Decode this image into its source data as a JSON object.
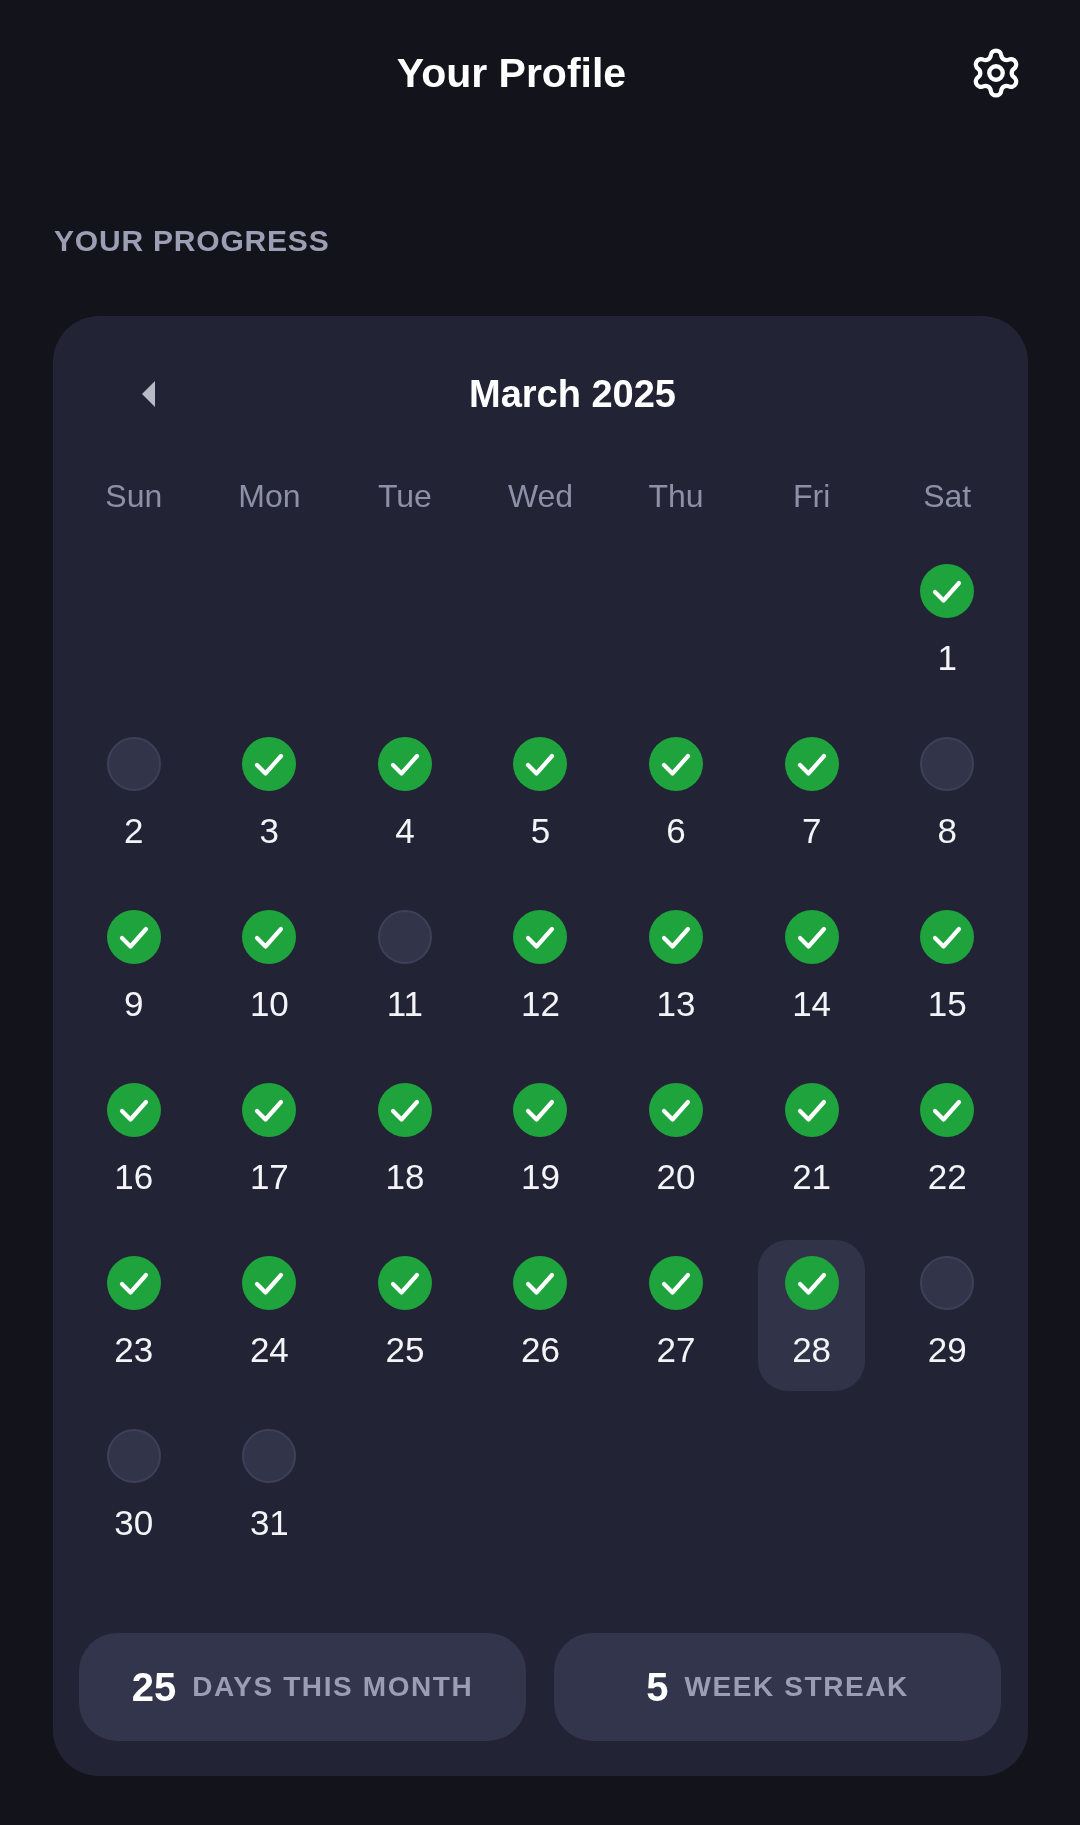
{
  "header": {
    "title": "Your Profile"
  },
  "section_title": "YOUR PROGRESS",
  "calendar": {
    "month": "March 2025",
    "weekdays": [
      "Sun",
      "Mon",
      "Tue",
      "Wed",
      "Thu",
      "Fri",
      "Sat"
    ],
    "weeks": [
      [
        {
          "day": "1",
          "checked": true,
          "selected": false
        }
      ],
      [
        {
          "day": "2",
          "checked": false,
          "selected": false
        },
        {
          "day": "3",
          "checked": true,
          "selected": false
        },
        {
          "day": "4",
          "checked": true,
          "selected": false
        },
        {
          "day": "5",
          "checked": true,
          "selected": false
        },
        {
          "day": "6",
          "checked": true,
          "selected": false
        },
        {
          "day": "7",
          "checked": true,
          "selected": false
        },
        {
          "day": "8",
          "checked": false,
          "selected": false
        }
      ],
      [
        {
          "day": "9",
          "checked": true,
          "selected": false
        },
        {
          "day": "10",
          "checked": true,
          "selected": false
        },
        {
          "day": "11",
          "checked": false,
          "selected": false
        },
        {
          "day": "12",
          "checked": true,
          "selected": false
        },
        {
          "day": "13",
          "checked": true,
          "selected": false
        },
        {
          "day": "14",
          "checked": true,
          "selected": false
        },
        {
          "day": "15",
          "checked": true,
          "selected": false
        }
      ],
      [
        {
          "day": "16",
          "checked": true,
          "selected": false
        },
        {
          "day": "17",
          "checked": true,
          "selected": false
        },
        {
          "day": "18",
          "checked": true,
          "selected": false
        },
        {
          "day": "19",
          "checked": true,
          "selected": false
        },
        {
          "day": "20",
          "checked": true,
          "selected": false
        },
        {
          "day": "21",
          "checked": true,
          "selected": false
        },
        {
          "day": "22",
          "checked": true,
          "selected": false
        }
      ],
      [
        {
          "day": "23",
          "checked": true,
          "selected": false
        },
        {
          "day": "24",
          "checked": true,
          "selected": false
        },
        {
          "day": "25",
          "checked": true,
          "selected": false
        },
        {
          "day": "26",
          "checked": true,
          "selected": false
        },
        {
          "day": "27",
          "checked": true,
          "selected": false
        },
        {
          "day": "28",
          "checked": true,
          "selected": true
        },
        {
          "day": "29",
          "checked": false,
          "selected": false
        }
      ],
      [
        {
          "day": "30",
          "checked": false,
          "selected": false
        },
        {
          "day": "31",
          "checked": false,
          "selected": false
        }
      ]
    ]
  },
  "stats": [
    {
      "value": "25",
      "label": "DAYS THIS MONTH"
    },
    {
      "value": "5",
      "label": "WEEK STREAK"
    }
  ]
}
